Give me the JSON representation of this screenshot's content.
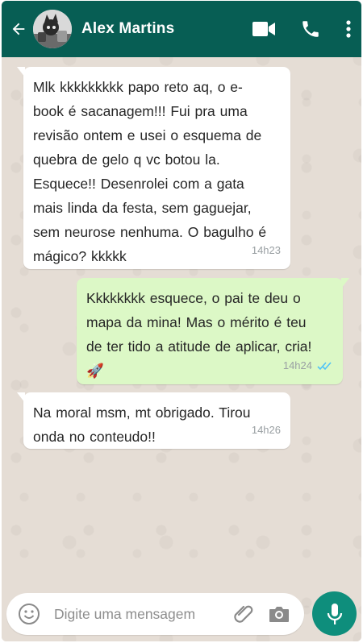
{
  "header": {
    "contact_name": "Alex Martins",
    "back_icon": "arrow-left-icon",
    "video_icon": "videocam-icon",
    "call_icon": "phone-icon",
    "menu_icon": "more-vert-icon",
    "bar_color": "#075e54"
  },
  "messages": [
    {
      "direction": "incoming",
      "text": "Mlk kkkkkkkkk papo reto aq, o e-\nbook é sacanagem!!! Fui pra uma\nrevisão ontem e usei o esquema de\nquebra de gelo q vc botou la.\nEsquece!! Desenrolei com a gata\nmais linda da festa, sem gaguejar,\nsem neurose nenhuma. O bagulho é\nmágico? kkkkk",
      "time": "14h23"
    },
    {
      "direction": "outgoing",
      "text": "Kkkkkkkk esquece, o pai te deu o\nmapa da mina! Mas o mérito é teu\nde ter tido a atitude de aplicar, cria!\n🚀",
      "time": "14h24",
      "status_icon": "double-check-read-icon"
    },
    {
      "direction": "incoming",
      "text": "Na moral msm, mt obrigado. Tirou\nonda no conteudo!!",
      "time": "14h26"
    }
  ],
  "composer": {
    "placeholder": "Digite uma mensagem",
    "emoji_icon": "emoji-icon",
    "attach_icon": "paperclip-icon",
    "camera_icon": "camera-icon",
    "mic_icon": "mic-icon"
  },
  "colors": {
    "incoming_bubble": "#ffffff",
    "outgoing_bubble": "#dcf8c6",
    "accent": "#0e8e7c",
    "read_ticks": "#4fc3f7"
  }
}
